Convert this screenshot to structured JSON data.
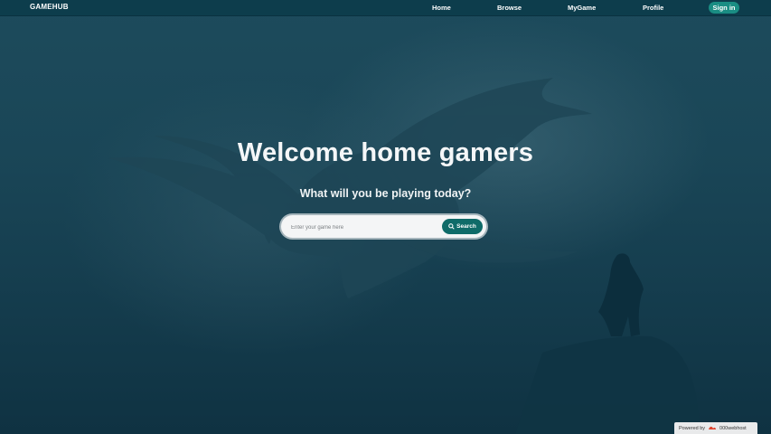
{
  "header": {
    "brand": "GAMEHUB",
    "nav": [
      {
        "label": "Home"
      },
      {
        "label": "Browse"
      },
      {
        "label": "MyGame"
      },
      {
        "label": "Profile"
      }
    ],
    "signin_label": "Sign in"
  },
  "hero": {
    "title": "Welcome home gamers",
    "subtitle": "What will you be playing today?"
  },
  "search": {
    "placeholder": "Enter your game here",
    "button_label": "Search",
    "button_icon": "search-icon"
  },
  "footer_badge": {
    "powered_by": "Powered by",
    "host": "000webhost"
  },
  "colors": {
    "navbar": "#0d3d4c",
    "accent": "#1a8d83",
    "search_button": "#0f6b69",
    "background": "#1a4657"
  }
}
